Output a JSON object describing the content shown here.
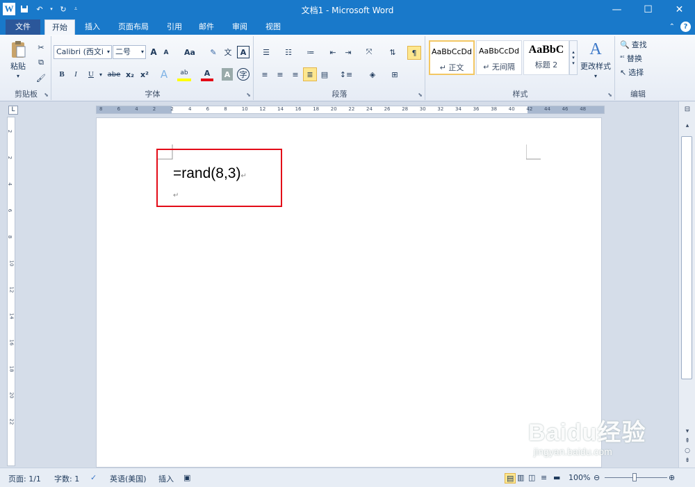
{
  "window": {
    "title": "文档1 - Microsoft Word",
    "app_logo": "W"
  },
  "tabs": [
    {
      "label": "文件"
    },
    {
      "label": "开始"
    },
    {
      "label": "插入"
    },
    {
      "label": "页面布局"
    },
    {
      "label": "引用"
    },
    {
      "label": "邮件"
    },
    {
      "label": "审阅"
    },
    {
      "label": "视图"
    }
  ],
  "clipboard": {
    "paste_label": "粘贴",
    "group_label": "剪贴板"
  },
  "font": {
    "name": "Calibri (西文i",
    "size": "二号",
    "group_label": "字体",
    "grow": "A",
    "shrink": "A",
    "case": "Aa",
    "bold": "B",
    "italic": "I",
    "underline": "U",
    "strike": "abe",
    "sub": "x₂",
    "sup": "x²",
    "wen": "文",
    "color_a": "A",
    "border_a": "A",
    "enclose": "字"
  },
  "paragraph": {
    "group_label": "段落"
  },
  "styles": {
    "group_label": "样式",
    "cards": [
      {
        "preview": "AaBbCcDd",
        "name": "↵ 正文"
      },
      {
        "preview": "AaBbCcDd",
        "name": "↵ 无间隔"
      },
      {
        "preview": "AaBbC",
        "name": "标题 2"
      }
    ],
    "change_label": "更改样式"
  },
  "editing": {
    "group_label": "编辑",
    "find": "查找",
    "replace": "替换",
    "select": "选择"
  },
  "ruler_h": [
    "8",
    "6",
    "4",
    "2",
    "2",
    "4",
    "6",
    "8",
    "10",
    "12",
    "14",
    "16",
    "18",
    "20",
    "22",
    "24",
    "26",
    "28",
    "30",
    "32",
    "34",
    "36",
    "38",
    "40",
    "42",
    "44",
    "46",
    "48"
  ],
  "ruler_v": [
    "2",
    "2",
    "4",
    "6",
    "8",
    "10",
    "12",
    "14",
    "16",
    "18",
    "20",
    "22"
  ],
  "document": {
    "line1": "=rand(8,3)",
    "pilcrow": "↵"
  },
  "status": {
    "page": "页面: 1/1",
    "words": "字数: 1",
    "language": "英语(美国)",
    "insert": "插入",
    "zoom": "100%"
  },
  "watermark": {
    "text": "Baidu经验",
    "sub": "jingyan.baidu.com"
  },
  "colors": {
    "titlebar": "#1979ca",
    "highlight_box": "#e30b17"
  }
}
